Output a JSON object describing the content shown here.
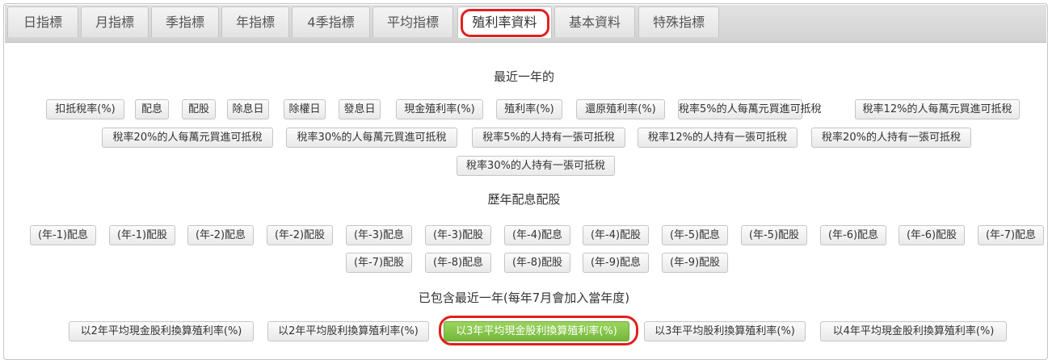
{
  "tabs": [
    {
      "label": "日指標"
    },
    {
      "label": "月指標"
    },
    {
      "label": "季指標"
    },
    {
      "label": "年指標"
    },
    {
      "label": "4季指標"
    },
    {
      "label": "平均指標"
    },
    {
      "label": "殖利率資料"
    },
    {
      "label": "基本資料"
    },
    {
      "label": "特殊指標"
    }
  ],
  "active_tab": "殖利率資料",
  "sections": {
    "recent": {
      "title": "最近一年的",
      "buttons": [
        "扣抵稅率(%)",
        "配息",
        "配股",
        "除息日",
        "除權日",
        "發息日",
        "現金殖利率(%)",
        "殖利率(%)",
        "還原殖利率(%)",
        "稅率5%的人每萬元買進可抵稅",
        "稅率12%的人每萬元買進可抵稅",
        "稅率20%的人每萬元買進可抵稅",
        "稅率30%的人每萬元買進可抵稅",
        "稅率5%的人持有一張可抵稅",
        "稅率12%的人持有一張可抵稅",
        "稅率20%的人持有一張可抵稅",
        "稅率30%的人持有一張可抵稅"
      ]
    },
    "history": {
      "title": "歷年配息配股",
      "buttons": [
        "(年-1)配息",
        "(年-1)配股",
        "(年-2)配息",
        "(年-2)配股",
        "(年-3)配息",
        "(年-3)配股",
        "(年-4)配息",
        "(年-4)配股",
        "(年-5)配息",
        "(年-5)配股",
        "(年-6)配息",
        "(年-6)配股",
        "(年-7)配息",
        "(年-7)配股",
        "(年-8)配息",
        "(年-8)配股",
        "(年-9)配息",
        "(年-9)配股"
      ]
    },
    "average": {
      "title": "已包含最近一年(每年7月會加入當年度)",
      "buttons": [
        "以2年平均現金股利換算殖利率(%)",
        "以2年平均股利換算殖利率(%)",
        "以3年平均現金股利換算殖利率(%)",
        "以3年平均股利換算殖利率(%)",
        "以4年平均現金股利換算殖利率(%)"
      ],
      "selected": "以3年平均現金股利換算殖利率(%)"
    }
  },
  "colors": {
    "highlight_red": "#e0201f",
    "selected_green": "#7dc242"
  }
}
